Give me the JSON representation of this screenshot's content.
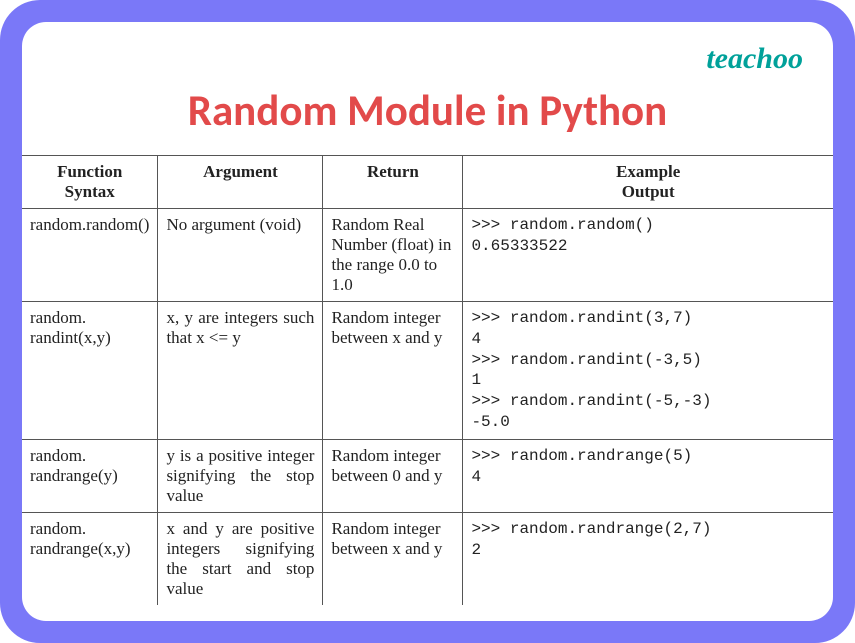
{
  "brand": "teachoo",
  "title": "Random Module in Python",
  "headers": {
    "c1a": "Function",
    "c1b": "Syntax",
    "c2": "Argument",
    "c3": "Return",
    "c4a": "Example",
    "c4b": "Output"
  },
  "rows": [
    {
      "syntax": "random.random()",
      "argument": "No argument (void)",
      "ret": "Random Real Number (float) in the range 0.0 to 1.0",
      "example": ">>> random.random()\n0.65333522"
    },
    {
      "syntax": "random. randint(x,y)",
      "argument": "x, y are integers such that\nx <= y",
      "ret": "Random integer between x and y",
      "example": ">>> random.randint(3,7)\n4\n>>> random.randint(-3,5)\n1\n>>> random.randint(-5,-3)\n-5.0"
    },
    {
      "syntax": "random. randrange(y)",
      "argument": "y is a positive integer signifying the stop value",
      "ret": "Random integer between 0 and y",
      "example": ">>> random.randrange(5)\n4"
    },
    {
      "syntax": "random. randrange(x,y)",
      "argument": "x and y are positive integers signifying the start and stop value",
      "ret": "Random integer between x and y",
      "example": ">>> random.randrange(2,7)\n2"
    }
  ]
}
